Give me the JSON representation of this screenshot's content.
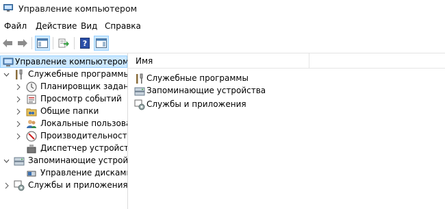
{
  "window": {
    "title": "Управление компьютером"
  },
  "menu": [
    "Файл",
    "Действие",
    "Вид",
    "Справка"
  ],
  "toolbar": {
    "buttons": [
      {
        "name": "back-arrow-icon",
        "active": false
      },
      {
        "name": "forward-arrow-icon",
        "active": false
      },
      {
        "name": "console-tree-icon",
        "active": true
      },
      {
        "name": "export-list-icon",
        "active": false
      },
      {
        "name": "help-icon",
        "active": false
      },
      {
        "name": "action-pane-icon",
        "active": true
      }
    ]
  },
  "tree": {
    "root": "Управление компьютером (локальным)",
    "groups": [
      {
        "label": "Служебные программы",
        "icon": "tools-icon",
        "expanded": true,
        "items": [
          {
            "label": "Планировщик заданий",
            "icon": "clock-icon"
          },
          {
            "label": "Просмотр событий",
            "icon": "event-viewer-icon"
          },
          {
            "label": "Общие папки",
            "icon": "shared-folder-icon"
          },
          {
            "label": "Локальные пользователи и группы",
            "icon": "users-icon"
          },
          {
            "label": "Производительность",
            "icon": "performance-icon"
          },
          {
            "label": "Диспетчер устройств",
            "icon": "device-manager-icon"
          }
        ]
      },
      {
        "label": "Запоминающие устройства",
        "icon": "storage-icon",
        "expanded": true,
        "items": [
          {
            "label": "Управление дисками",
            "icon": "disk-management-icon"
          }
        ]
      },
      {
        "label": "Службы и приложения",
        "icon": "services-icon",
        "expanded": false,
        "items": []
      }
    ]
  },
  "list": {
    "column": "Имя",
    "items": [
      {
        "label": "Служебные программы",
        "icon": "tools-icon"
      },
      {
        "label": "Запоминающие устройства",
        "icon": "storage-icon"
      },
      {
        "label": "Службы и приложения",
        "icon": "services-icon"
      }
    ]
  }
}
